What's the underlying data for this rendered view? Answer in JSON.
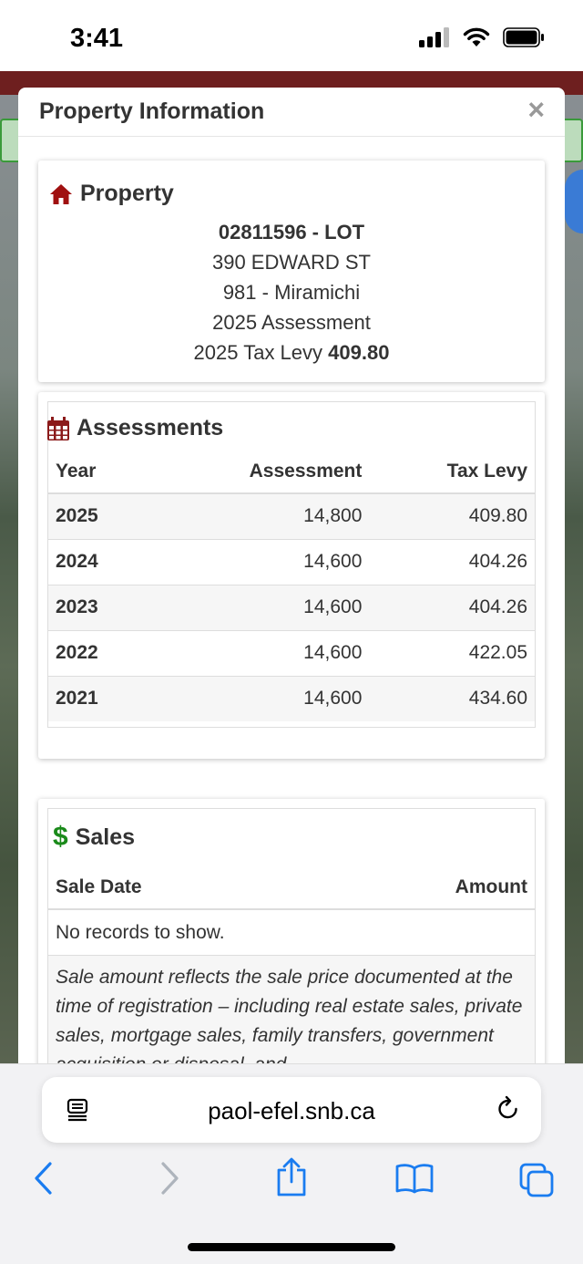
{
  "status": {
    "time": "3:41"
  },
  "modal": {
    "title": "Property Information",
    "close": "×"
  },
  "property": {
    "title": "Property",
    "pid": "02811596 -  LOT",
    "address": "390 EDWARD ST",
    "municipality": "981 - Miramichi",
    "assessment_label": "2025 Assessment",
    "levy_label": "2025 Tax Levy ",
    "levy_value": "409.80"
  },
  "assessments": {
    "title": "Assessments",
    "headers": [
      "Year",
      "Assessment",
      "Tax Levy"
    ],
    "rows": [
      [
        "2025",
        "14,800",
        "409.80"
      ],
      [
        "2024",
        "14,600",
        "404.26"
      ],
      [
        "2023",
        "14,600",
        "404.26"
      ],
      [
        "2022",
        "14,600",
        "422.05"
      ],
      [
        "2021",
        "14,600",
        "434.60"
      ]
    ]
  },
  "sales": {
    "title": "Sales",
    "headers": [
      "Sale Date",
      "Amount"
    ],
    "empty": "No records to show.",
    "note": "Sale amount reflects the sale price documented at the time of registration – including real estate sales, private sales, mortgage sales, family transfers, government acquisition or disposal, and"
  },
  "browser": {
    "url": "paol-efel.snb.ca"
  },
  "colors": {
    "property_icon": "#a01010",
    "calendar_icon": "#8b1a1a",
    "dollar_icon": "#1a8a1a",
    "ios_blue": "#1a7cf0"
  }
}
